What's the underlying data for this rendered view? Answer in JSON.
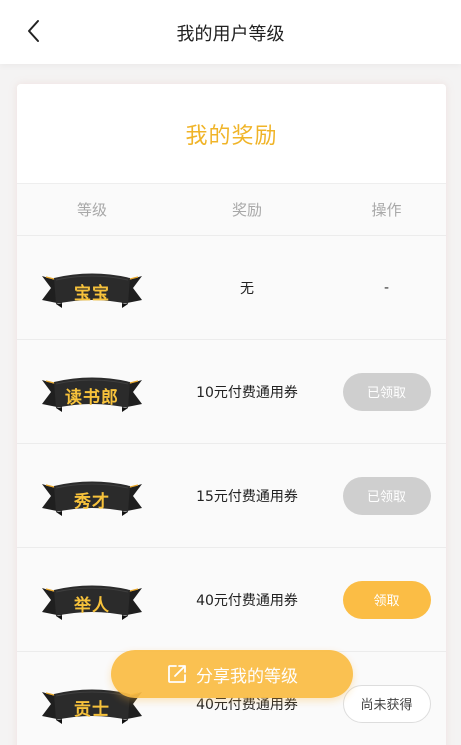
{
  "header": {
    "title": "我的用户等级"
  },
  "card": {
    "title": "我的奖励",
    "columns": {
      "level": "等级",
      "reward": "奖励",
      "action": "操作"
    },
    "rows": [
      {
        "level": "宝宝",
        "reward": "无",
        "action": "-",
        "state": "none"
      },
      {
        "level": "读书郎",
        "reward": "10元付费通用券",
        "action": "已领取",
        "state": "received"
      },
      {
        "level": "秀才",
        "reward": "15元付费通用券",
        "action": "已领取",
        "state": "received"
      },
      {
        "level": "举人",
        "reward": "40元付费通用券",
        "action": "领取",
        "state": "claimable"
      },
      {
        "level": "贡士",
        "reward": "40元付费通用券",
        "action": "尚未获得",
        "state": "locked"
      }
    ]
  },
  "share": {
    "label": "分享我的等级"
  },
  "colors": {
    "accent": "#fbbd45",
    "title": "#f0b428",
    "disabled": "#cfcfcf"
  },
  "icons": {
    "back": "chevron-left-icon",
    "share": "share-icon",
    "badge": "ribbon-badge-icon"
  }
}
